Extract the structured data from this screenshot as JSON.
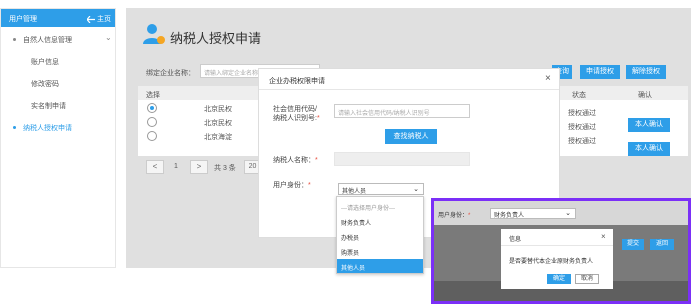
{
  "sidebar": {
    "header_title": "用户管理",
    "home_label": "主页",
    "items": [
      {
        "label": "自然人信息管理",
        "expanded": true
      },
      {
        "label": "账户信息"
      },
      {
        "label": "修改密码"
      },
      {
        "label": "实名制申请"
      },
      {
        "label": "纳税人授权申请",
        "active": true
      }
    ]
  },
  "page": {
    "title": "纳税人授权申请",
    "bind_label": "绑定企业名称：",
    "bind_placeholder": "请输入绑定企业名称",
    "toolbar": {
      "query": "查询",
      "apply": "申请授权",
      "revoke": "解除授权"
    },
    "table": {
      "headers": {
        "select": "选择",
        "status": "状态",
        "confirm": "确认"
      },
      "rows": [
        {
          "company": "北京民权",
          "status": "授权通过",
          "selected": true,
          "confirm": ""
        },
        {
          "company": "北京民权",
          "status": "授权通过",
          "selected": false,
          "confirm": "本人确认"
        },
        {
          "company": "北京海淀",
          "status": "授权通过",
          "selected": false,
          "confirm": "本人确认"
        }
      ]
    },
    "pager": {
      "prev": "<",
      "page": "1",
      "next": ">",
      "total": "共 3 条",
      "size": "20 条"
    }
  },
  "modal": {
    "title": "企业办税权限申请",
    "close": "×",
    "credit_label_1": "社会信用代码/",
    "credit_label_2": "纳税人识别号:",
    "credit_placeholder": "请输入社会信用代码/纳税人识别号",
    "find_button": "查找纳税人",
    "name_label": "纳税人名称：",
    "role_label": "用户身份：",
    "role_value": "其他人员",
    "role_options": [
      {
        "label": "---请选择用户身份---",
        "placeholder": true
      },
      {
        "label": "财务负责人"
      },
      {
        "label": "办税员"
      },
      {
        "label": "购票员"
      },
      {
        "label": "其他人员",
        "selected": true
      }
    ]
  },
  "inset": {
    "role_label": "用户身份：",
    "role_value": "财务负责人",
    "dialog_title": "信息",
    "dialog_close": "×",
    "dialog_message": "是否要替代本企业原财务负责人",
    "ok": "确定",
    "cancel": "取消",
    "submit": "提交",
    "back": "返回",
    "border_color": "#7b2ff7"
  },
  "colors": {
    "accent": "#2e9ee8",
    "required": "#e74c3c"
  }
}
